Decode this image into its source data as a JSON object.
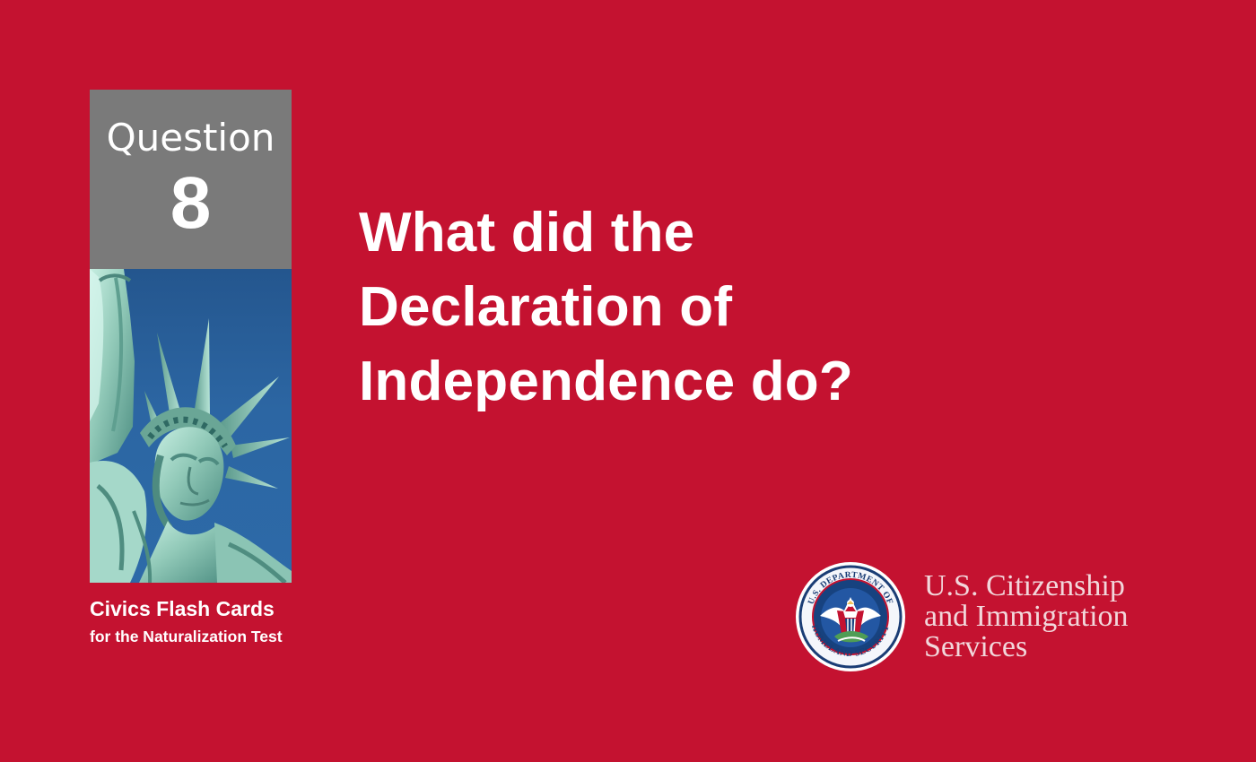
{
  "card": {
    "question_label": "Question",
    "question_number": "8",
    "question_lines": [
      "What did the",
      "Declaration of",
      "Independence do?"
    ],
    "series_title": "Civics Flash Cards",
    "series_subtitle": "for the Naturalization Test"
  },
  "agency": {
    "name_lines": [
      "U.S. Citizenship",
      "and Immigration",
      "Services"
    ],
    "seal_text": "U.S. DEPARTMENT OF HOMELAND SECURITY"
  },
  "colors": {
    "background": "#c41230",
    "question_box": "#7a7a7a",
    "text": "#ffffff",
    "agency_text": "#f2d7db",
    "sky": "#2c66a3",
    "statue": "#9fcfc0"
  },
  "images": {
    "statue": "statue-of-liberty-image",
    "seal": "dhs-seal-logo"
  }
}
